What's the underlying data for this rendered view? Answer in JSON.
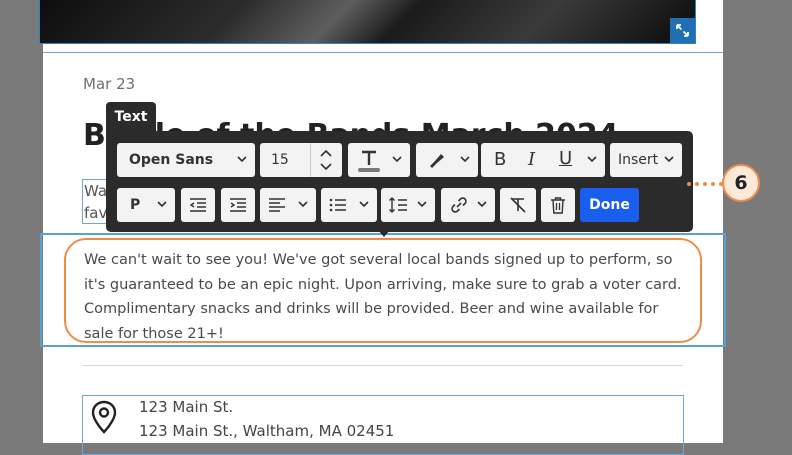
{
  "post": {
    "date": "Mar 23",
    "title": "Battle of the Bands March 2024",
    "subtitle_partial": "Wa fave",
    "body": "We can't wait to see you! We've got several local bands signed up to perform, so it's guaranteed to be an epic night. Upon arriving, make sure to grab a voter card. Complimentary snacks and drinks will be provided. Beer and wine available for sale for those 21+!",
    "address_line1": "123 Main St.",
    "address_line2": "123 Main St., Waltham, MA 02451"
  },
  "toolbar": {
    "label": "Text",
    "font_family": "Open Sans",
    "font_size": "15",
    "insert_label": "Insert",
    "paragraph_label": "P",
    "done_label": "Done"
  },
  "callout": {
    "number": "6"
  },
  "colors": {
    "accent_blue": "#1a5ef0",
    "callout_orange": "#f08c4b",
    "selection_blue": "#5aa0d0",
    "toolbar_bg": "#2b2b2b"
  }
}
